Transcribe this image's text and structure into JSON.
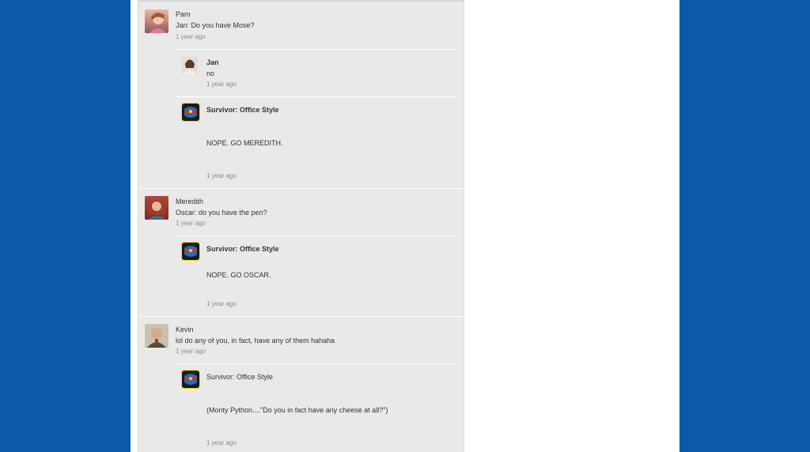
{
  "threads": [
    {
      "author": "Pam",
      "message": "Jan:  Do you have Mose?",
      "time": "1 year ago",
      "replies": [
        {
          "author": "Jan",
          "message": "no",
          "time": "1 year ago"
        },
        {
          "author": "Survivor: Office Style",
          "message": "NOPE.  GO MEREDITH.",
          "time": "1 year ago"
        }
      ]
    },
    {
      "author": "Meredith",
      "message": "Oscar: do you have the pen?",
      "time": "1 year ago",
      "replies": [
        {
          "author": "Survivor: Office Style",
          "message": "NOPE.  GO OSCAR.",
          "time": "1 year ago"
        }
      ]
    },
    {
      "author": "Kevin",
      "message": "lol do any of you, in fact, have any of them hahaha",
      "time": "1 year ago",
      "replies": [
        {
          "author": "Survivor: Office Style",
          "message": "(Monty Python....\"Do you in fact have any cheese at all?\")",
          "time": "1 year ago"
        }
      ]
    }
  ]
}
